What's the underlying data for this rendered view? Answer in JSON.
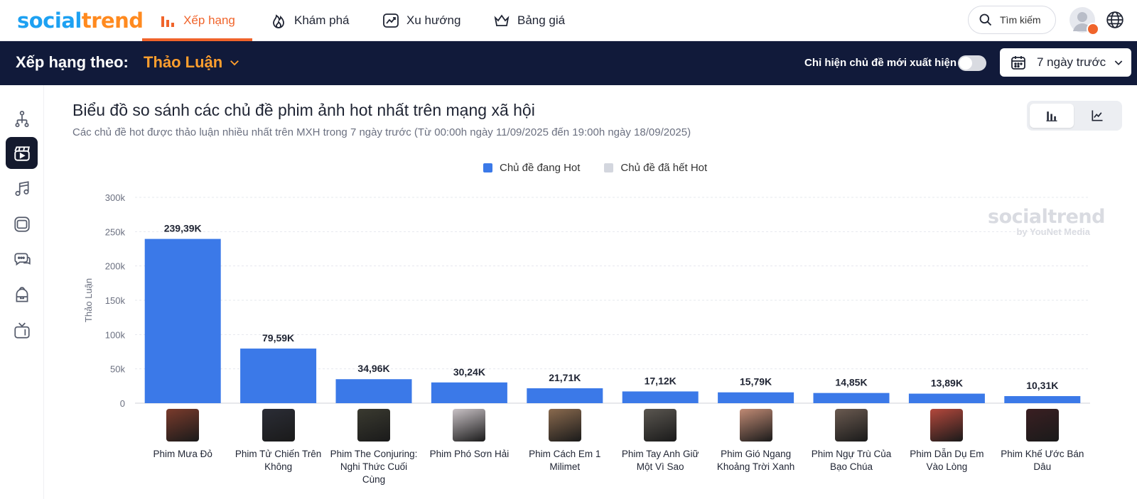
{
  "nav": {
    "logo_part1": "social",
    "logo_part2": "trend",
    "items": [
      {
        "label": "Xếp hạng",
        "icon": "bar-chart-icon",
        "active": true
      },
      {
        "label": "Khám phá",
        "icon": "flame-icon",
        "active": false
      },
      {
        "label": "Xu hướng",
        "icon": "trend-icon",
        "active": false
      },
      {
        "label": "Bảng giá",
        "icon": "crown-icon",
        "active": false
      }
    ],
    "search_label": "Tìm kiếm"
  },
  "rankbar": {
    "label": "Xếp hạng theo:",
    "value": "Thảo Luận",
    "toggle_label": "Chỉ hiện chủ đề mới xuất hiện",
    "toggle_on": false,
    "date_range": "7 ngày trước"
  },
  "sidebar": {
    "items": [
      {
        "icon": "people-hierarchy-icon",
        "active": false
      },
      {
        "icon": "film-clapper-icon",
        "active": true
      },
      {
        "icon": "music-note-icon",
        "active": false
      },
      {
        "icon": "app-window-icon",
        "active": false
      },
      {
        "icon": "chat-bubbles-icon",
        "active": false
      },
      {
        "icon": "backpack-icon",
        "active": false
      },
      {
        "icon": "tv-icon",
        "active": false
      }
    ]
  },
  "panel": {
    "title": "Biểu đồ so sánh các chủ đề phim ảnh hot nhất trên mạng xã hội",
    "subtitle": "Các chủ đề hot được thảo luận nhiều nhất trên MXH trong 7 ngày trước (Từ 00:00h ngày 11/09/2025 đến 19:00h ngày 18/09/2025)",
    "watermark_1": "socialtrend",
    "watermark_2": "by YouNet Media"
  },
  "colors": {
    "hot": "#3b79e8",
    "not_hot": "#d3d6de",
    "accent": "#f0642b",
    "dark": "#111a3a"
  },
  "chart_data": {
    "type": "bar",
    "legend": [
      "Chủ đề đang Hot",
      "Chủ đề đã hết Hot"
    ],
    "legend_position": "top-center",
    "ylabel": "Thảo Luận",
    "ylim": [
      0,
      300000
    ],
    "yticks": [
      0,
      50000,
      100000,
      150000,
      200000,
      250000,
      300000
    ],
    "ytick_labels": [
      "0",
      "50k",
      "100k",
      "150k",
      "200k",
      "250k",
      "300k"
    ],
    "grid": true,
    "categories": [
      "Phim Mưa Đỏ",
      "Phim Tử Chiến Trên Không",
      "Phim The Conjuring: Nghi Thức Cuối Cùng",
      "Phim Phó Sơn Hải",
      "Phim Cách Em 1 Milimet",
      "Phim Tay Anh Giữ Một Vì Sao",
      "Phim Gió Ngang Khoảng Trời Xanh",
      "Phim Ngự Trù Của Bạo Chúa",
      "Phim Dẫn Dụ Em Vào Lòng",
      "Phim Khế Ước Bán Dâu"
    ],
    "series": [
      {
        "name": "Chủ đề đang Hot",
        "values": [
          239390,
          79590,
          34960,
          30240,
          21710,
          17120,
          15790,
          14850,
          13890,
          10310
        ],
        "labels": [
          "239,39K",
          "79,59K",
          "34,96K",
          "30,24K",
          "21,71K",
          "17,12K",
          "15,79K",
          "14,85K",
          "13,89K",
          "10,31K"
        ]
      }
    ],
    "thumb_colors": [
      "#7a3b2c",
      "#2b2d36",
      "#3a3a30",
      "#c9c2c6",
      "#8a6a4e",
      "#5a5650",
      "#c08a74",
      "#6a5a50",
      "#b4483c",
      "#3a1f22"
    ]
  }
}
